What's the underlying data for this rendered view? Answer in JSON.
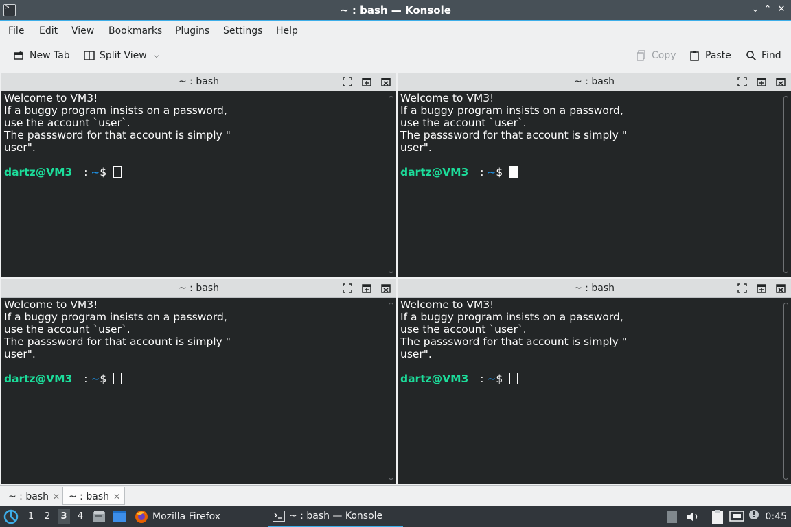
{
  "window": {
    "title": "~ : bash — Konsole",
    "app_icon": "terminal-icon"
  },
  "menubar": {
    "items": [
      "File",
      "Edit",
      "View",
      "Bookmarks",
      "Plugins",
      "Settings",
      "Help"
    ]
  },
  "toolbar": {
    "new_tab": "New Tab",
    "split_view": "Split View",
    "copy": "Copy",
    "paste": "Paste",
    "find": "Find"
  },
  "panes": [
    {
      "title": "~ : bash",
      "lines": [
        "Welcome to VM3!",
        "If a buggy program insists on a password,",
        "use the account `user`.",
        "The passsword for that account is simply \"",
        "user\"."
      ],
      "prompt_user": "dartz@VM3",
      "prompt_sep": " : ",
      "prompt_path": "~",
      "prompt_end": "$",
      "cursor": "hollow"
    },
    {
      "title": "~ : bash",
      "lines": [
        "Welcome to VM3!",
        "If a buggy program insists on a password,",
        "use the account `user`.",
        "The passsword for that account is simply \"",
        "user\"."
      ],
      "prompt_user": "dartz@VM3",
      "prompt_sep": " : ",
      "prompt_path": "~",
      "prompt_end": "$",
      "cursor": "solid"
    },
    {
      "title": "~ : bash",
      "lines": [
        "Welcome to VM3!",
        "If a buggy program insists on a password,",
        "use the account `user`.",
        "The passsword for that account is simply \"",
        "user\"."
      ],
      "prompt_user": "dartz@VM3",
      "prompt_sep": " : ",
      "prompt_path": "~",
      "prompt_end": "$",
      "cursor": "hollow"
    },
    {
      "title": "~ : bash",
      "lines": [
        "Welcome to VM3!",
        "If a buggy program insists on a password,",
        "use the account `user`.",
        "The passsword for that account is simply \"",
        "user\"."
      ],
      "prompt_user": "dartz@VM3",
      "prompt_sep": " : ",
      "prompt_path": "~",
      "prompt_end": "$",
      "cursor": "hollow"
    }
  ],
  "tabs": [
    {
      "label": "~ : bash",
      "active": false
    },
    {
      "label": "~ : bash",
      "active": true
    }
  ],
  "taskbar": {
    "workspaces": [
      "1",
      "2",
      "3",
      "4"
    ],
    "active_workspace": "3",
    "firefox": "Mozilla Firefox",
    "konsole": "~ : bash — Konsole",
    "clock": "0:45"
  },
  "colors": {
    "accent": "#3daee9",
    "prompt_user": "#1cdc9a",
    "prompt_path": "#1d99f3",
    "terminal_bg": "#232627"
  }
}
